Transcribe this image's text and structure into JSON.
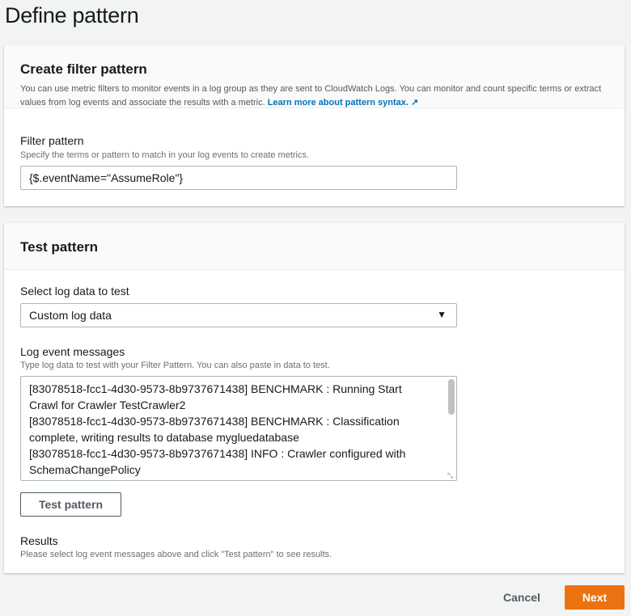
{
  "page": {
    "title": "Define pattern"
  },
  "create": {
    "title": "Create filter pattern",
    "description": "You can use metric filters to monitor events in a log group as they are sent to CloudWatch Logs. You can monitor and count specific terms or extract values from log events and associate the results with a metric.",
    "link": "Learn more about pattern syntax.",
    "link_icon": "external-link-icon",
    "field_label": "Filter pattern",
    "field_help": "Specify the terms or pattern to match in your log events to create metrics.",
    "field_value": "{$.eventName=\"AssumeRole\"}"
  },
  "test": {
    "title": "Test pattern",
    "select_label": "Select log data to test",
    "select_value": "Custom log data",
    "messages_label": "Log event messages",
    "messages_help": "Type log data to test with your Filter Pattern. You can also paste in data to test.",
    "messages": [
      "[83078518-fcc1-4d30-9573-8b9737671438] BENCHMARK : Running Start",
      "Crawl for Crawler TestCrawler2",
      "[83078518-fcc1-4d30-9573-8b9737671438] BENCHMARK : Classification",
      "complete, writing results to database mygluedatabase",
      "[83078518-fcc1-4d30-9573-8b9737671438] INFO : Crawler configured with",
      "SchemaChangePolicy"
    ],
    "button": "Test pattern",
    "results_label": "Results",
    "results_help": "Please select log event messages above and click \"Test pattern\" to see results."
  },
  "footer": {
    "cancel": "Cancel",
    "next": "Next"
  },
  "colors": {
    "accent": "#ec7211",
    "link": "#0073bb"
  }
}
